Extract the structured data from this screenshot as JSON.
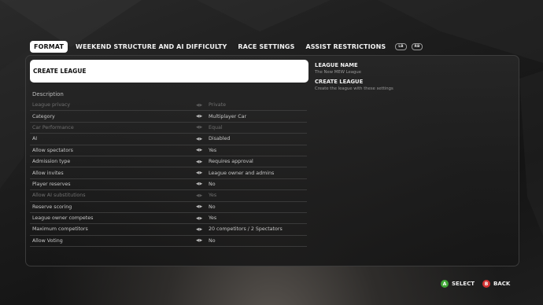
{
  "tabs": [
    {
      "label": "FORMAT",
      "active": true
    },
    {
      "label": "WEEKEND STRUCTURE AND AI DIFFICULTY",
      "active": false
    },
    {
      "label": "RACE SETTINGS",
      "active": false
    },
    {
      "label": "ASSIST RESTRICTIONS",
      "active": false
    }
  ],
  "bumpers": {
    "left": "LB",
    "right": "RB"
  },
  "create_button_label": "CREATE LEAGUE",
  "description_label": "Description",
  "settings": [
    {
      "label": "League privacy",
      "value": "Private",
      "enabled": false
    },
    {
      "label": "Category",
      "value": "Multiplayer Car",
      "enabled": true
    },
    {
      "label": "Car Performance",
      "value": "Equal",
      "enabled": false
    },
    {
      "label": "AI",
      "value": "Disabled",
      "enabled": true
    },
    {
      "label": "Allow spectators",
      "value": "Yes",
      "enabled": true
    },
    {
      "label": "Admission type",
      "value": "Requires approval",
      "enabled": true
    },
    {
      "label": "Allow invites",
      "value": "League owner and admins",
      "enabled": true
    },
    {
      "label": "Player reserves",
      "value": "No",
      "enabled": true
    },
    {
      "label": "Allow AI substitutions",
      "value": "Yes",
      "enabled": false
    },
    {
      "label": "Reserve scoring",
      "value": "No",
      "enabled": true
    },
    {
      "label": "League owner competes",
      "value": "Yes",
      "enabled": true
    },
    {
      "label": "Maximum competitors",
      "value": "20 competitors / 2 Spectators",
      "enabled": true
    },
    {
      "label": "Allow Voting",
      "value": "No",
      "enabled": true
    }
  ],
  "info": {
    "league_name_heading": "LEAGUE NAME",
    "league_name_value": "The New MEW League",
    "create_heading": "CREATE LEAGUE",
    "create_desc": "Create the league with these settings"
  },
  "footer": {
    "select_key": "A",
    "select_label": "SELECT",
    "back_key": "B",
    "back_label": "BACK"
  },
  "colors": {
    "a_button": "#3fa535",
    "b_button": "#d23131",
    "active_tab_bg": "#ffffff"
  }
}
